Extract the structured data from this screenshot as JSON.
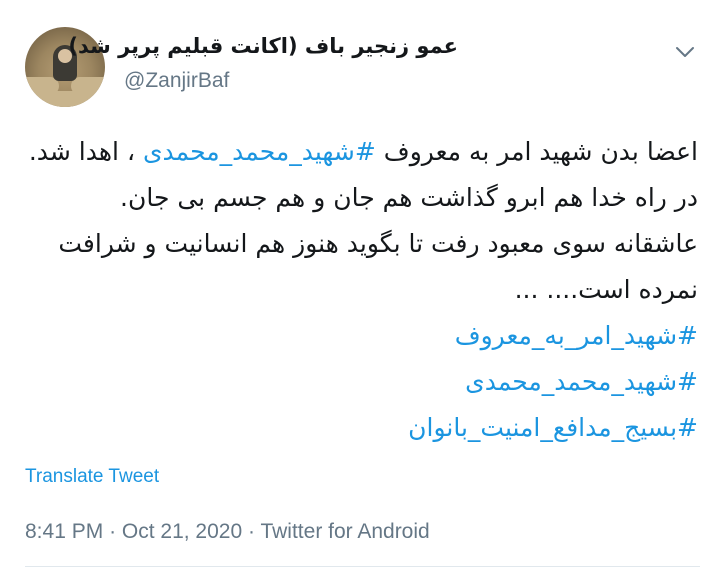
{
  "tweet": {
    "author": {
      "display_name": "عمو زنجیر باف (اکانت قبلیم پرپر شد)",
      "handle": "@ZanjirBaf"
    },
    "text": {
      "p1_before": "اعضا بدن شهید امر به معروف ",
      "p1_hashtag": "#شهید_محمد_محمدی",
      "p1_after": " ، اهدا شد.",
      "line2": "در راه خدا هم ابرو گذاشت هم جان و هم جسم بی جان.",
      "line3": "عاشقانه سوی معبود رفت تا بگوید هنوز هم انسانیت و شرافت نمرده است.... ..."
    },
    "hashtags": [
      "#شهید_امر_به_معروف",
      "#شهید_محمد_محمدی",
      "#بسیج_مدافع_امنیت_بانوان"
    ],
    "translate_label": "Translate Tweet",
    "meta": {
      "time": "8:41 PM",
      "date": "Oct 21, 2020",
      "source": "Twitter for Android",
      "separator": "·"
    }
  },
  "icons": {
    "more": "chevron-down-icon",
    "avatar": "profile-photo"
  },
  "colors": {
    "link": "#1b95e0",
    "secondary_text": "#657786",
    "primary_text": "#14171a",
    "divider": "#e1e8ed"
  }
}
